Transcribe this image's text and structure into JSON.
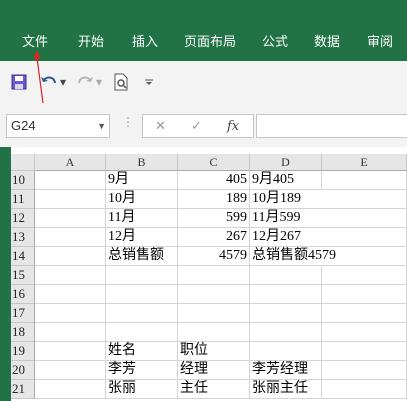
{
  "ribbon": {
    "tabs": [
      "文件",
      "开始",
      "插入",
      "页面布局",
      "公式",
      "数据",
      "审阅"
    ]
  },
  "quick_access": {
    "icons": [
      "save-icon",
      "undo-icon",
      "redo-icon",
      "print-preview-icon",
      "customize-icon"
    ]
  },
  "formula_bar": {
    "name_box": "G24",
    "cancel_symbol": "✕",
    "enter_symbol": "✓",
    "fx_label": "fx",
    "value": ""
  },
  "sheet": {
    "columns": [
      "A",
      "B",
      "C",
      "D",
      "E"
    ],
    "rows": [
      {
        "num": "10",
        "B": "9月",
        "C": "405",
        "D": "9月405"
      },
      {
        "num": "11",
        "B": "10月",
        "C": "189",
        "D": "10月189"
      },
      {
        "num": "12",
        "B": "11月",
        "C": "599",
        "D": "11月599"
      },
      {
        "num": "13",
        "B": "12月",
        "C": "267",
        "D": "12月267"
      },
      {
        "num": "14",
        "B": "总销售额",
        "C": "4579",
        "D": "总销售额4579"
      },
      {
        "num": "15",
        "B": "",
        "C": "",
        "D": ""
      },
      {
        "num": "16",
        "B": "",
        "C": "",
        "D": ""
      },
      {
        "num": "17",
        "B": "",
        "C": "",
        "D": ""
      },
      {
        "num": "18",
        "B": "",
        "C": "",
        "D": ""
      },
      {
        "num": "19",
        "B": "姓名",
        "C": "职位",
        "D": ""
      },
      {
        "num": "20",
        "B": "李芳",
        "C": "经理",
        "D": "李芳经理"
      },
      {
        "num": "21",
        "B": "张丽",
        "C": "主任",
        "D": "张丽主任"
      }
    ]
  },
  "colors": {
    "ribbon_green": "#217346",
    "annotation_red": "#e02020"
  }
}
